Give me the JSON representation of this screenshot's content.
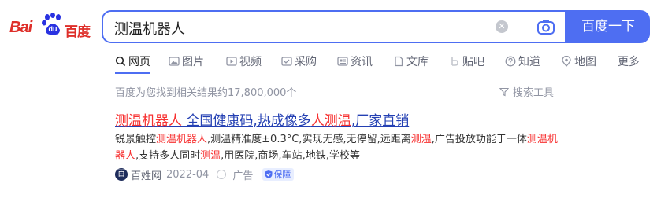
{
  "logo": {
    "text_latin": "Bai",
    "text_paw": "du",
    "text_cn": "百度"
  },
  "search": {
    "query": "测温机器人",
    "button_label": "百度一下"
  },
  "tabs": [
    {
      "label": "网页",
      "icon": "search-icon"
    },
    {
      "label": "图片",
      "icon": "image-icon"
    },
    {
      "label": "视频",
      "icon": "video-icon"
    },
    {
      "label": "采购",
      "icon": "purchase-icon"
    },
    {
      "label": "资讯",
      "icon": "news-icon"
    },
    {
      "label": "文库",
      "icon": "doc-icon"
    },
    {
      "label": "贴吧",
      "icon": "tieba-icon"
    },
    {
      "label": "知道",
      "icon": "question-icon"
    },
    {
      "label": "地图",
      "icon": "map-pin-icon"
    },
    {
      "label": "更多",
      "icon": ""
    }
  ],
  "results_count": "百度为您找到相关结果约17,800,000个",
  "search_tools": "搜索工具",
  "result": {
    "title_hl1": "测温机器人",
    "title_mid1": " 全国健康码,热成像多",
    "title_hl2": "人测温",
    "title_tail": ",厂家直销",
    "snip": [
      {
        "t": "锐景触控",
        "h": false
      },
      {
        "t": "测温机器人",
        "h": true
      },
      {
        "t": ",测温精准度±0.3°C,实现无感,无停留,远距离",
        "h": false
      },
      {
        "t": "测温",
        "h": true
      },
      {
        "t": ",广告投放功能于一体",
        "h": false
      },
      {
        "t": "测温机器人",
        "h": true
      },
      {
        "t": ",支持多人同时",
        "h": false
      },
      {
        "t": "测温",
        "h": true
      },
      {
        "t": ",用医院,商场,车站,地铁,学校等",
        "h": false
      }
    ],
    "source_icon_text": "百",
    "source": "百姓网",
    "date": "2022-04",
    "ad_label": "广告",
    "guarantee_label": "保障"
  },
  "colors": {
    "brand_blue": "#4e6ef2",
    "highlight_red": "#f73131",
    "link_blue": "#2440b3"
  }
}
